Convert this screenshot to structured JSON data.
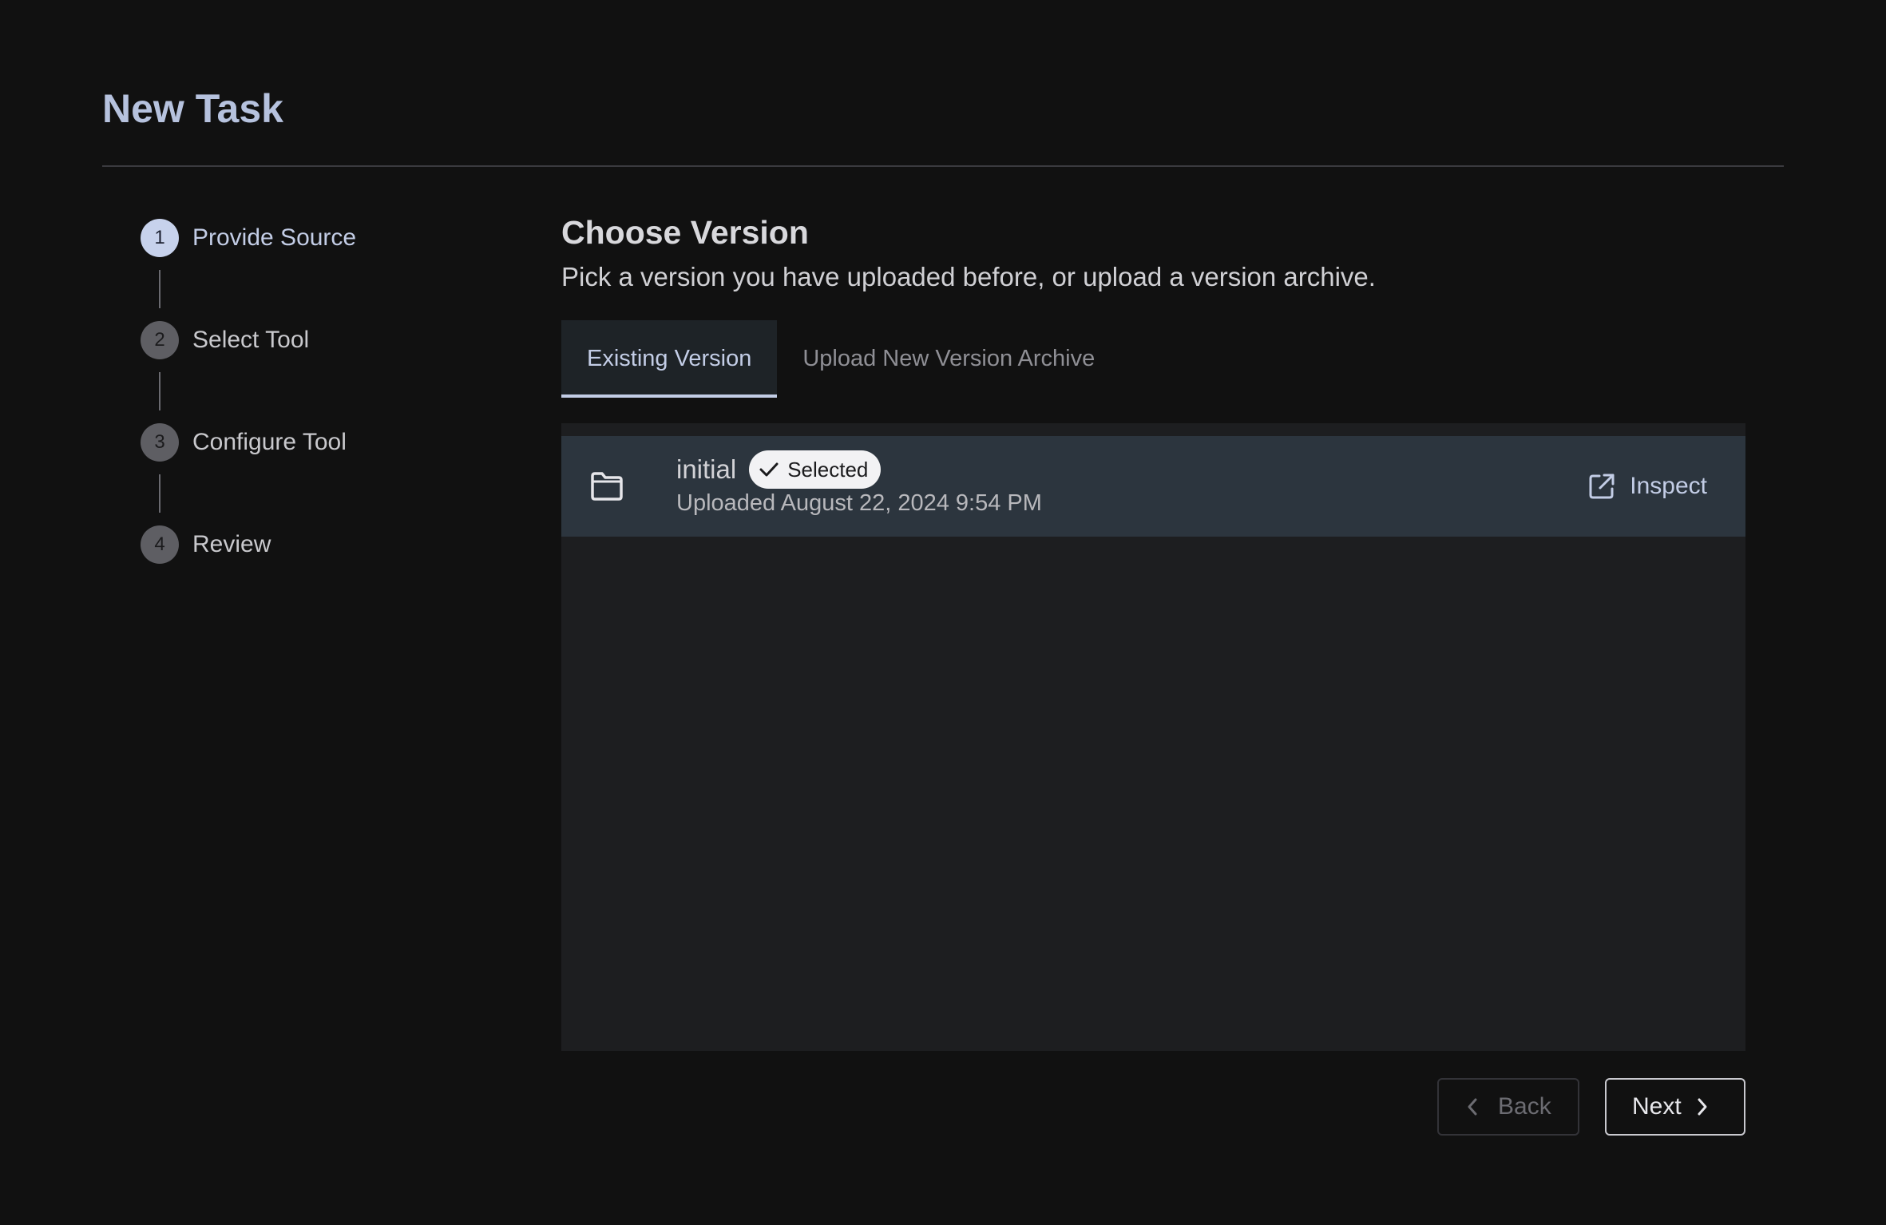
{
  "page": {
    "title": "New Task"
  },
  "stepper": {
    "steps": [
      {
        "number": "1",
        "label": "Provide Source",
        "active": true
      },
      {
        "number": "2",
        "label": "Select Tool",
        "active": false
      },
      {
        "number": "3",
        "label": "Configure Tool",
        "active": false
      },
      {
        "number": "4",
        "label": "Review",
        "active": false
      }
    ]
  },
  "main": {
    "title": "Choose Version",
    "subtitle": "Pick a version you have uploaded before, or upload a version archive.",
    "tabs": [
      {
        "label": "Existing Version",
        "active": true
      },
      {
        "label": "Upload New Version Archive",
        "active": false
      }
    ],
    "versions": [
      {
        "icon": "folder-icon",
        "name": "initial",
        "badge": "Selected",
        "badge_icon": "check-icon",
        "uploaded": "Uploaded August 22, 2024 9:54 PM",
        "action_label": "Inspect",
        "action_icon": "external-link-icon"
      }
    ]
  },
  "footer": {
    "back_label": "Back",
    "back_icon": "chevron-left-icon",
    "next_label": "Next",
    "next_icon": "chevron-right-icon"
  },
  "colors": {
    "background": "#111111",
    "accent": "#c3cde6",
    "panel": "#1d1e20",
    "selected_row": "#2c353e"
  }
}
